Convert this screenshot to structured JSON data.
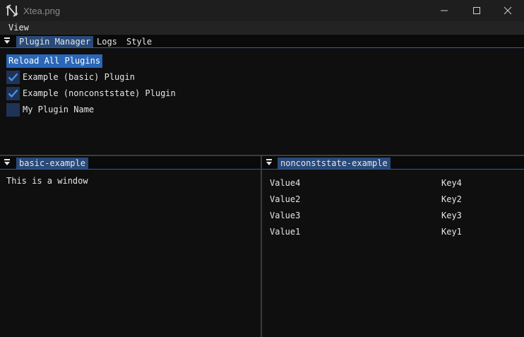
{
  "window": {
    "title": "Xtea.png",
    "icon": "xtea-app-icon",
    "controls": [
      "minimize-icon",
      "maximize-icon",
      "close-icon"
    ]
  },
  "menubar": {
    "items": [
      {
        "label": "View"
      }
    ]
  },
  "plugin_panel": {
    "tabs": [
      {
        "label": "Plugin Manager",
        "active": true
      },
      {
        "label": "Logs",
        "active": false
      },
      {
        "label": "Style",
        "active": false
      }
    ],
    "reload_button": "Reload All Plugins",
    "plugins": [
      {
        "label": "Example (basic) Plugin",
        "checked": true
      },
      {
        "label": "Example (nonconststate) Plugin",
        "checked": true
      },
      {
        "label": "My Plugin Name",
        "checked": false
      }
    ]
  },
  "basic_panel": {
    "tab": "basic-example",
    "text": "This is a window"
  },
  "nonconst_panel": {
    "tab": "nonconststate-example",
    "rows": [
      {
        "value": "Value4",
        "key": "Key4"
      },
      {
        "value": "Value2",
        "key": "Key2"
      },
      {
        "value": "Value3",
        "key": "Key3"
      },
      {
        "value": "Value1",
        "key": "Key1"
      }
    ]
  },
  "colors": {
    "accent": "#2b67b8",
    "tab_active": "#294a7a",
    "checkbox_bg": "#1f3357",
    "check_mark": "#4a90e2",
    "background": "#0f0f0f"
  }
}
